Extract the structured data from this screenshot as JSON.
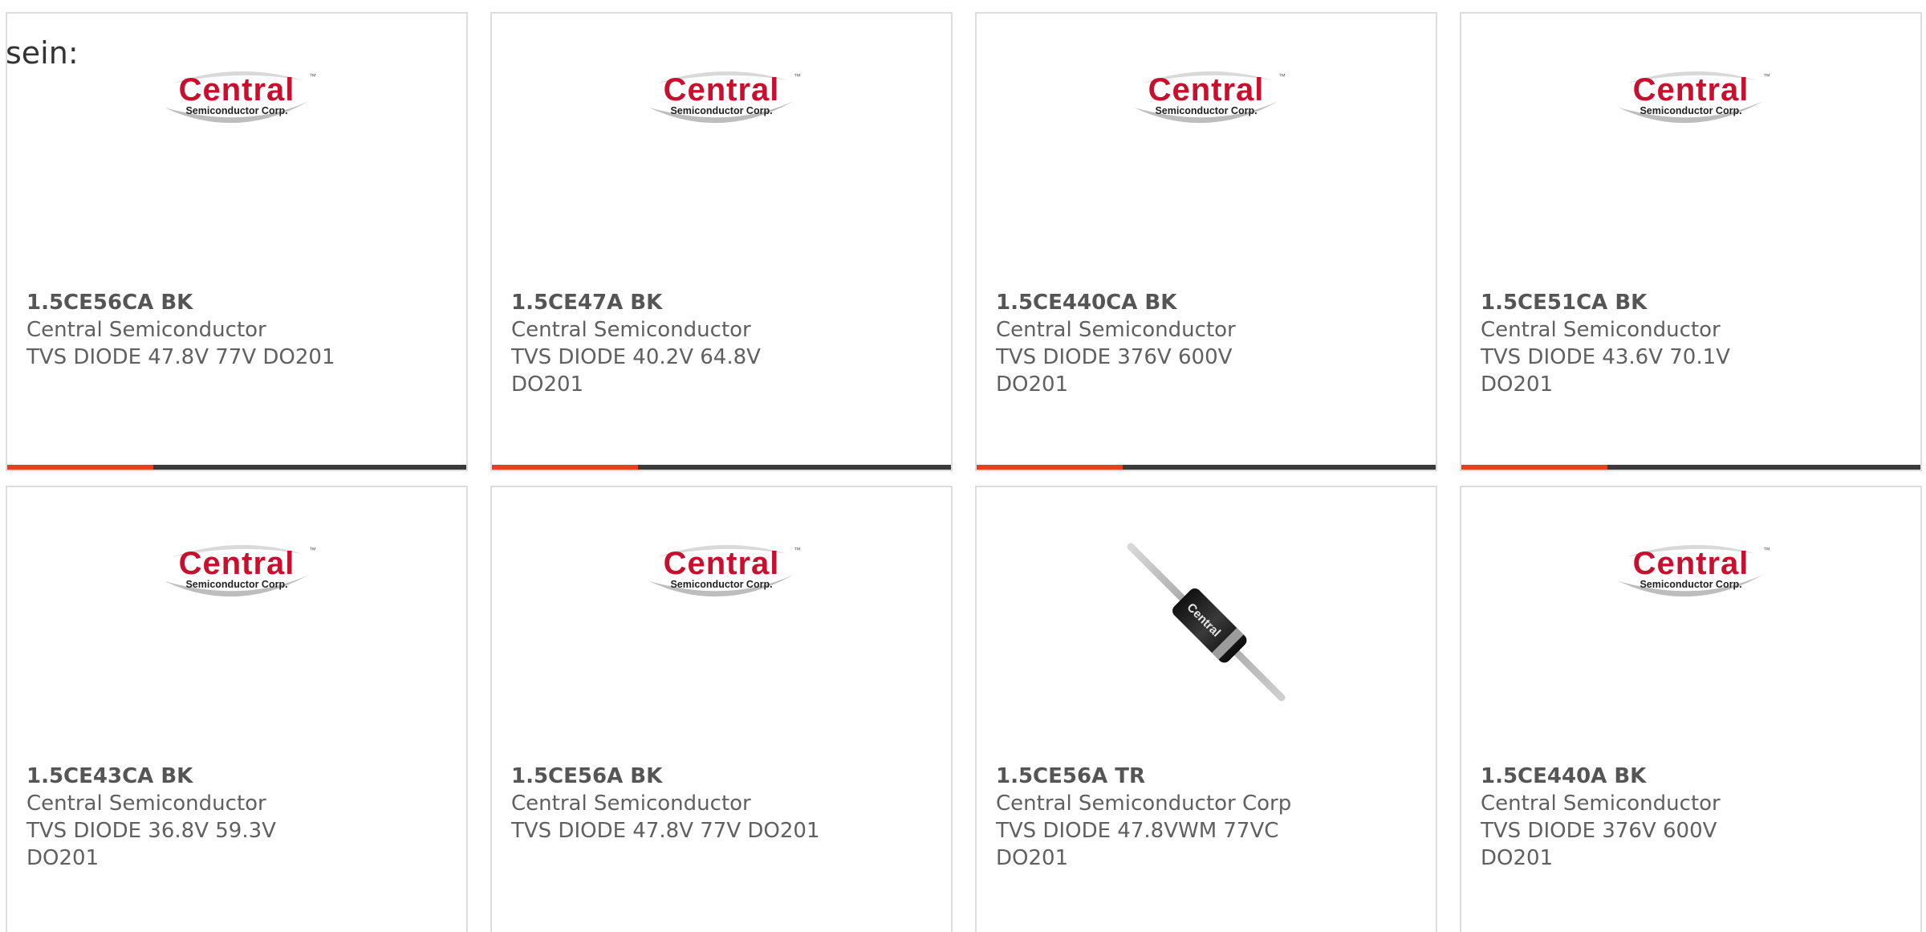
{
  "intro_text": "sein:",
  "colors": {
    "accent": "#e8401c",
    "bar": "#3a3a3a",
    "border": "#dddddd",
    "logo_red": "#c8102e"
  },
  "logo": {
    "word": "Central",
    "sub": "Semiconductor Corp.",
    "tm": "™"
  },
  "diode_label": "Central",
  "products": [
    {
      "part_number": "1.5CE56CA BK",
      "manufacturer": "Central Semiconductor",
      "description": "TVS DIODE 47.8V 77V DO201",
      "image": "central-logo"
    },
    {
      "part_number": "1.5CE47A BK",
      "manufacturer": "Central Semiconductor",
      "description": "TVS DIODE 40.2V 64.8V DO201",
      "image": "central-logo"
    },
    {
      "part_number": "1.5CE440CA BK",
      "manufacturer": "Central Semiconductor",
      "description": "TVS DIODE 376V 600V DO201",
      "image": "central-logo"
    },
    {
      "part_number": "1.5CE51CA BK",
      "manufacturer": "Central Semiconductor",
      "description": "TVS DIODE 43.6V 70.1V DO201",
      "image": "central-logo"
    },
    {
      "part_number": "1.5CE43CA BK",
      "manufacturer": "Central Semiconductor",
      "description": "TVS DIODE 36.8V 59.3V DO201",
      "image": "central-logo"
    },
    {
      "part_number": "1.5CE56A BK",
      "manufacturer": "Central Semiconductor",
      "description": "TVS DIODE 47.8V 77V DO201",
      "image": "central-logo"
    },
    {
      "part_number": "1.5CE56A TR",
      "manufacturer": "Central Semiconductor Corp",
      "description": "TVS DIODE 47.8VWM 77VC DO201",
      "image": "diode-photo"
    },
    {
      "part_number": "1.5CE440A BK",
      "manufacturer": "Central Semiconductor",
      "description": "TVS DIODE 376V 600V DO201",
      "image": "central-logo"
    }
  ]
}
